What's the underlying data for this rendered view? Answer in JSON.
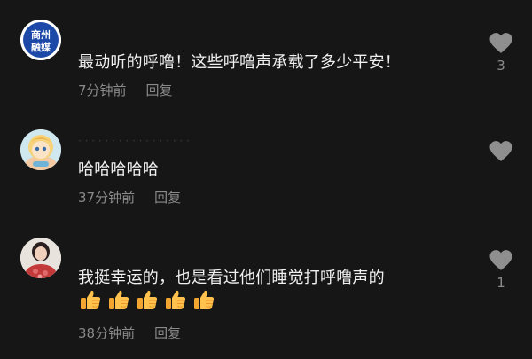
{
  "comments": [
    {
      "avatar_label_top": "商州",
      "avatar_label_bottom": "融媒",
      "text": "最动听的呼噜！这些呼噜声承载了多少平安！",
      "time": "7分钟前",
      "reply": "回复",
      "likes": "3"
    },
    {
      "text": "哈哈哈哈哈",
      "time": "37分钟前",
      "reply": "回复",
      "likes": ""
    },
    {
      "text": "我挺幸运的，也是看过他们睡觉打呼噜声的",
      "emoji": "👍👍👍👍👍",
      "time": "38分钟前",
      "reply": "回复",
      "likes": "1"
    }
  ],
  "colors": {
    "background": "#161616",
    "text": "#f0f0f0",
    "meta": "#8a8a8a",
    "heart": "#8f8f8f",
    "brand_avatar": "#1c49a8"
  },
  "icons": {
    "like": "heart-icon",
    "emoji": "thumbs-up-emoji"
  }
}
